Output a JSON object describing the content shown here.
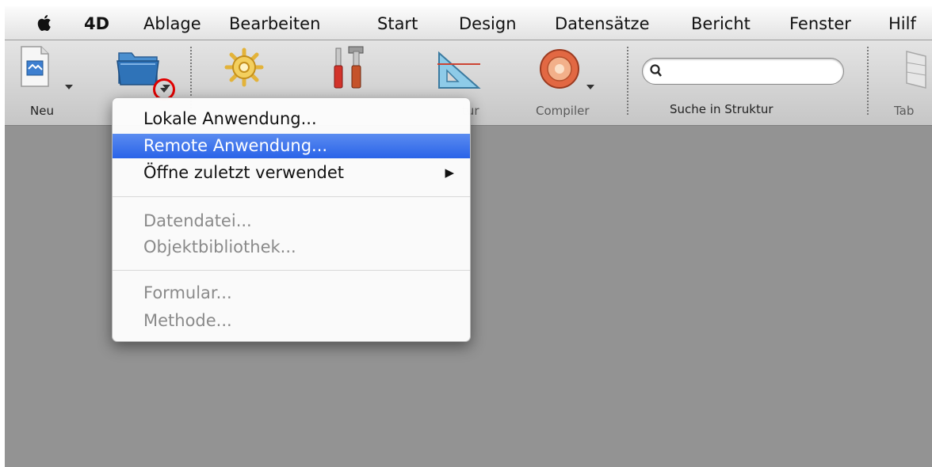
{
  "menubar": {
    "app_name": "4D",
    "items": [
      "Ablage",
      "Bearbeiten",
      "Start",
      "Design",
      "Datensätze",
      "Bericht",
      "Fenster",
      "Hilf"
    ]
  },
  "toolbar": {
    "new_label": "Neu",
    "structure_label_fragment": "tur",
    "compiler_label": "Compiler",
    "search_label": "Suche in Struktur",
    "search_placeholder": "",
    "tables_label_fragment": "Tab"
  },
  "open_menu": {
    "items": [
      {
        "label": "Lokale Anwendung...",
        "state": "enabled"
      },
      {
        "label": "Remote Anwendung...",
        "state": "selected"
      },
      {
        "label": "Öffne zuletzt verwendet",
        "state": "enabled",
        "submenu_arrow": "▶"
      },
      {
        "label": "Datendatei...",
        "state": "disabled"
      },
      {
        "label": "Objektbibliothek...",
        "state": "disabled"
      },
      {
        "label": "Formular...",
        "state": "disabled"
      },
      {
        "label": "Methode...",
        "state": "disabled"
      }
    ]
  },
  "colors": {
    "selection": "#3874ed",
    "background": "#939393",
    "highlight_circle": "#e00000"
  }
}
